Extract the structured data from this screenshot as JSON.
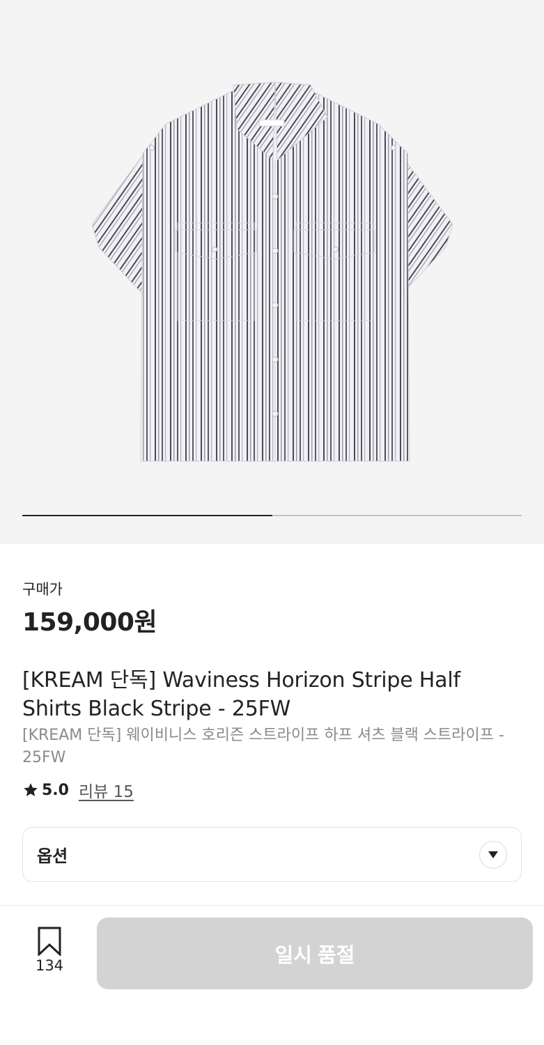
{
  "product": {
    "image": {
      "alt": "striped short sleeve shirt",
      "background": "#f4f4f4"
    },
    "carousel": {
      "current": 1,
      "total": 2,
      "progress": 0.5
    },
    "price_label": "구매가",
    "price": "159,000원",
    "title_en": "[KREAM 단독] Waviness Horizon Stripe Half Shirts Black Stripe - 25FW",
    "title_ko": "[KREAM 단독] 웨이비니스 호리즌 스트라이프 하프 셔츠 블랙 스트라이프 - 25FW",
    "rating": "5.0",
    "review_link": "리뷰 15"
  },
  "option": {
    "label": "옵션",
    "arrow_icon": "caret-down-icon"
  },
  "bottom_bar": {
    "bookmark_icon": "bookmark-icon",
    "bookmark_count": "134",
    "buy_button_label": "일시 품절",
    "buy_button_color": "#d3d3d3"
  }
}
